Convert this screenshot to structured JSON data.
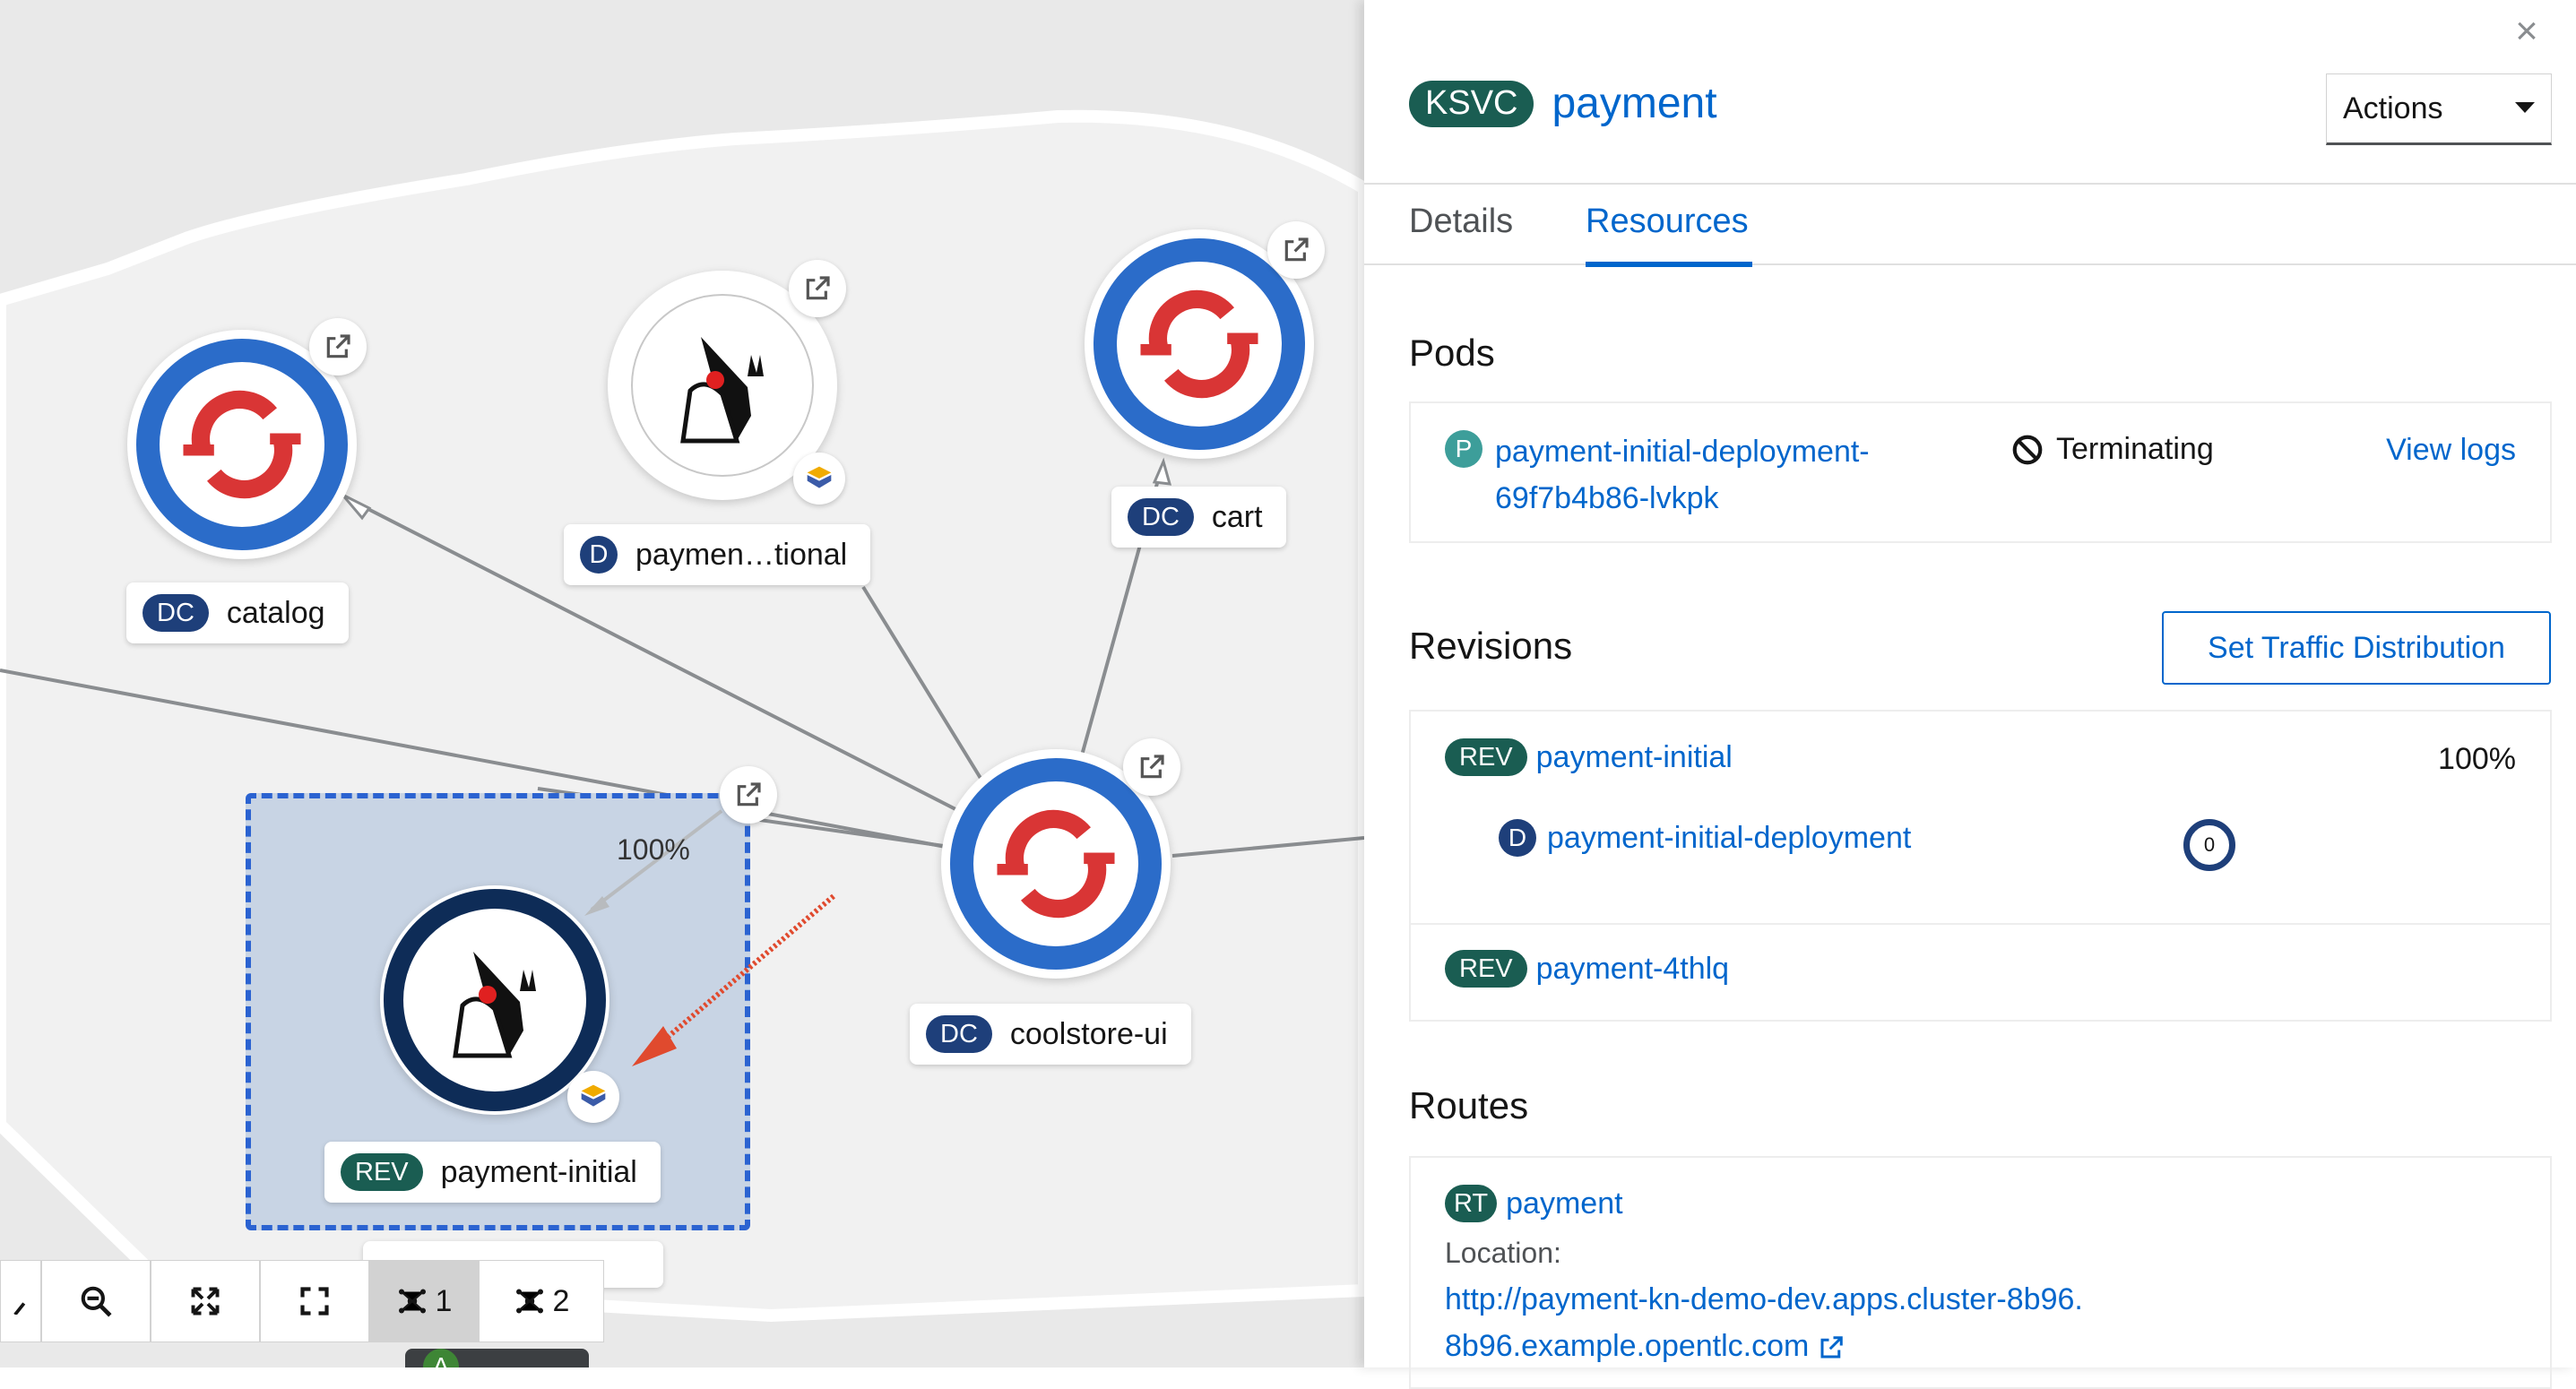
{
  "topology": {
    "links": [
      {
        "from": "catalog",
        "to": "coolstore-ui"
      },
      {
        "from": "payment-optional",
        "to": "coolstore-ui"
      },
      {
        "from": "cart",
        "to": "coolstore-ui"
      },
      {
        "from": "payment-initial",
        "to": "coolstore-ui"
      }
    ],
    "nodes": {
      "catalog": {
        "badge": "DC",
        "name": "catalog",
        "icon": "openshift-logo-icon"
      },
      "payment_optional": {
        "badge": "D",
        "name": "paymen…tional",
        "icon": "java-duke-icon"
      },
      "cart": {
        "badge": "DC",
        "name": "cart",
        "icon": "openshift-logo-icon"
      },
      "coolstore_ui": {
        "badge": "DC",
        "name": "coolstore-ui",
        "icon": "openshift-logo-icon"
      },
      "payment_initial": {
        "badge": "REV",
        "name": "payment-initial",
        "icon": "java-duke-icon",
        "traffic": "100%"
      }
    },
    "toolbar": {
      "zoom_out_icon": "zoom-out-icon",
      "fit_icon": "expand-icon",
      "fullscreen_icon": "fullscreen-icon",
      "layout1_label": "1",
      "layout2_label": "2",
      "hidden_badge": "A"
    }
  },
  "panel": {
    "close_label": "×",
    "badge": "KSVC",
    "title": "payment",
    "actions_label": "Actions",
    "tabs": [
      "Details",
      "Resources"
    ],
    "active_tab": "Resources",
    "pods": {
      "heading": "Pods",
      "items": [
        {
          "badge": "P",
          "name": "payment-initial-deployment-69f7b4b86-lvkpk",
          "status": "Terminating",
          "action": "View logs"
        }
      ]
    },
    "revisions": {
      "heading": "Revisions",
      "button": "Set Traffic Distribution",
      "items": [
        {
          "badge": "REV",
          "name": "payment-initial",
          "traffic": "100%",
          "deployment": {
            "badge": "D",
            "name": "payment-initial-deployment",
            "pods": "0"
          }
        },
        {
          "badge": "REV",
          "name": "payment-4thlq"
        }
      ]
    },
    "routes": {
      "heading": "Routes",
      "items": [
        {
          "badge": "RT",
          "name": "payment",
          "location_label": "Location:",
          "url": "http://payment-kn-demo-dev.apps.cluster-8b96.8b96.example.opentlc.com"
        }
      ]
    }
  },
  "colors": {
    "link": "#0066cc",
    "dc_badge": "#1e3f7a",
    "rev_badge": "#1a5d52",
    "openshift_red": "#d93535",
    "ring_blue": "#2b6cc9"
  }
}
